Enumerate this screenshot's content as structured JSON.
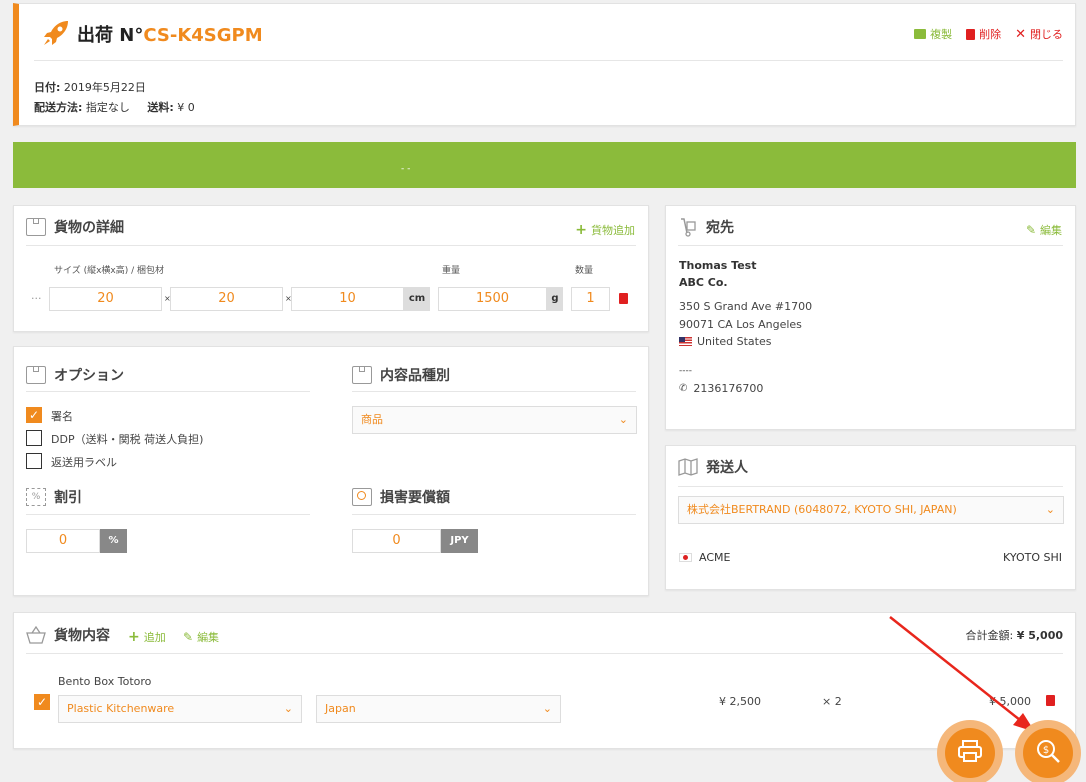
{
  "header": {
    "title_prefix": "出荷 N°",
    "shipment_id": "CS-K4SGPM",
    "duplicate": "複製",
    "delete": "削除",
    "close": "閉じる",
    "date_label": "日付:",
    "date_value": "2019年5月22日",
    "method_label": "配送方法:",
    "method_value": "指定なし",
    "shipping_label": "送料:",
    "shipping_value": "¥ 0"
  },
  "banner": {
    "text": "- -"
  },
  "cargo": {
    "title": "貨物の詳細",
    "add": "貨物追加",
    "size_label": "サイズ (縦x横x高) / 梱包材",
    "weight_label": "重量",
    "qty_label": "数量",
    "dots": "···",
    "length": "20",
    "width": "20",
    "height": "10",
    "times": "×",
    "dim_unit": "cm",
    "weight": "1500",
    "weight_unit": "g",
    "qty": "1"
  },
  "options": {
    "title": "オプション",
    "items": [
      {
        "label": "署名",
        "checked": true
      },
      {
        "label": "DDP（送料・関税 荷送人負担)",
        "checked": false
      },
      {
        "label": "返送用ラベル",
        "checked": false
      }
    ],
    "checkmark": "✓"
  },
  "content_type": {
    "title": "内容品種別",
    "selected": "商品",
    "chevron": "⌄"
  },
  "discount": {
    "title": "割引",
    "value": "0",
    "unit": "%"
  },
  "insurance": {
    "title": "損害要償額",
    "value": "0",
    "unit": "JPY"
  },
  "recipient": {
    "title": "宛先",
    "edit": "編集",
    "name": "Thomas Test",
    "company": "ABC Co.",
    "address1": "350 S Grand Ave #1700",
    "address2": "90071 CA Los Angeles",
    "country": "United States",
    "dashes": "----",
    "phone": "2136176700"
  },
  "sender": {
    "title": "発送人",
    "selected": "株式会社BERTRAND (6048072, KYOTO SHI, JAPAN)",
    "name": "ACME",
    "city": "KYOTO SHI"
  },
  "contents": {
    "title": "貨物内容",
    "add": "追加",
    "edit": "編集",
    "total_label": "合計金額:",
    "total_value": "¥ 5,000",
    "item": {
      "name": "Bento Box Totoro",
      "category": "Plastic Kitchenware",
      "origin": "Japan",
      "price": "¥ 2,500",
      "qty": "× 2",
      "subtotal": "¥ 5,000"
    }
  },
  "colors": {
    "accent": "#f08a1e",
    "green": "#8bbb3b",
    "red": "#e02020"
  }
}
